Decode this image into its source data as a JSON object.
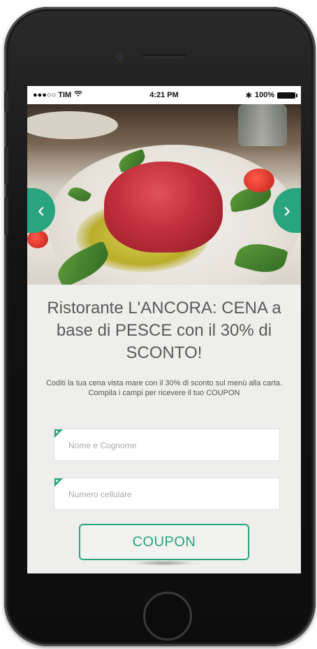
{
  "status_bar": {
    "carrier": "●●●○○ TIM",
    "wifi": "wifi-icon",
    "time": "4:21 PM",
    "bluetooth": "✱",
    "battery_percent": "100%"
  },
  "hero": {
    "prev_arrow": "‹",
    "next_arrow": "›"
  },
  "content": {
    "title": "Ristorante L'ANCORA: CENA a base di PESCE con il 30% di SCONTO!",
    "description_line1": "Coditi la tua cena vista mare con il 30% di sconto sul menù alla carta.",
    "description_line2": "Compila i campi per ricevere il tuo COUPON"
  },
  "form": {
    "name_placeholder": "Nome e Cognome",
    "phone_placeholder": "Numero cellulare",
    "coupon_button": "COUPON"
  },
  "colors": {
    "accent": "#2aa47e",
    "screen_bg": "#eeeeec",
    "title_text": "#5a5a5a"
  }
}
